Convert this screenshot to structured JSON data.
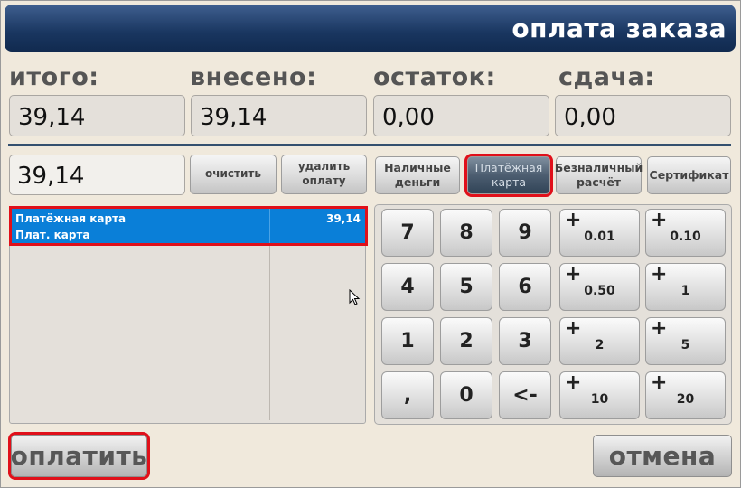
{
  "header": {
    "title": "оплата заказа"
  },
  "summary": [
    {
      "label": "итого:",
      "value": "39,14"
    },
    {
      "label": "внесено:",
      "value": "39,14"
    },
    {
      "label": "остаток:",
      "value": "0,00"
    },
    {
      "label": "сдача:",
      "value": "0,00"
    }
  ],
  "entry": {
    "value": "39,14"
  },
  "actions": {
    "clear_label": "очистить",
    "delete_line1": "удалить",
    "delete_line2": "оплату"
  },
  "payment_types": [
    {
      "line1": "Наличные",
      "line2": "деньги",
      "selected": false
    },
    {
      "line1": "Платёжная",
      "line2": "карта",
      "selected": true
    },
    {
      "line1": "Безналичный",
      "line2": "расчёт",
      "selected": false
    },
    {
      "line1": "Сертификат",
      "line2": "",
      "selected": false
    }
  ],
  "payments_list": [
    {
      "name": "Платёжная карта",
      "short_name": "Плат. карта",
      "amount": "39,14"
    }
  ],
  "keypad": {
    "digits": [
      "7",
      "8",
      "9",
      "4",
      "5",
      "6",
      "1",
      "2",
      "3",
      ",",
      "0",
      "<-"
    ],
    "quick_amounts": [
      "0.01",
      "0.10",
      "0.50",
      "1",
      "2",
      "5",
      "10",
      "20"
    ],
    "plus_sign": "+"
  },
  "footer": {
    "pay_label": "оплатить",
    "cancel_label": "отмена"
  },
  "colors": {
    "header_bg": "#193660",
    "selected_row": "#0a7fd8",
    "highlight": "#e0101a"
  }
}
